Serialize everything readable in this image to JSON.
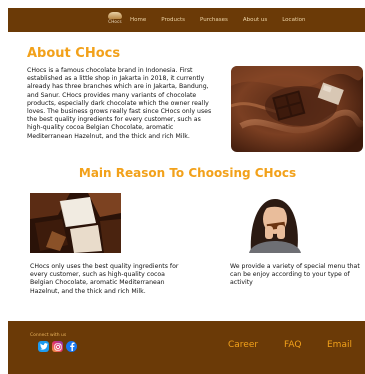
{
  "nav": {
    "logo_text": "CHocs",
    "items": [
      "Home",
      "Products",
      "Purchases",
      "About us",
      "Location"
    ]
  },
  "about": {
    "title": "About CHocs",
    "text": "CHocs is a famous chocolate brand in Indonesia. First established as a little shop in Jakarta in 2018, it currently already has three branches which are in Jakarta, Bandung, and Sanur. CHocs provides many variants of chocolate products, especially dark chocolate which the owner really loves. The business grows really fast since CHocs only uses the best quality ingredients for every customer, such as high-quality cocoa Belgian Chocolate, aromatic Mediterranean Hazelnut, and the thick and rich Milk."
  },
  "reasons": {
    "title": "Main Reason To Choosing CHocs",
    "items": [
      {
        "text": "CHocs only uses the best quality ingredients for every customer, such as high-quality cocoa Belgian Chocolate, aromatic Mediterranean Hazelnut, and the thick and rich Milk."
      },
      {
        "text": "We provide a variety of special menu that can be enjoy according to your type of activity"
      }
    ]
  },
  "footer": {
    "connect": "Connect with us",
    "links": [
      "Career",
      "FAQ",
      "Email"
    ]
  },
  "colors": {
    "nav_bg": "#6b3a07",
    "accent": "#f2a11a",
    "link": "#f0d7a8"
  }
}
